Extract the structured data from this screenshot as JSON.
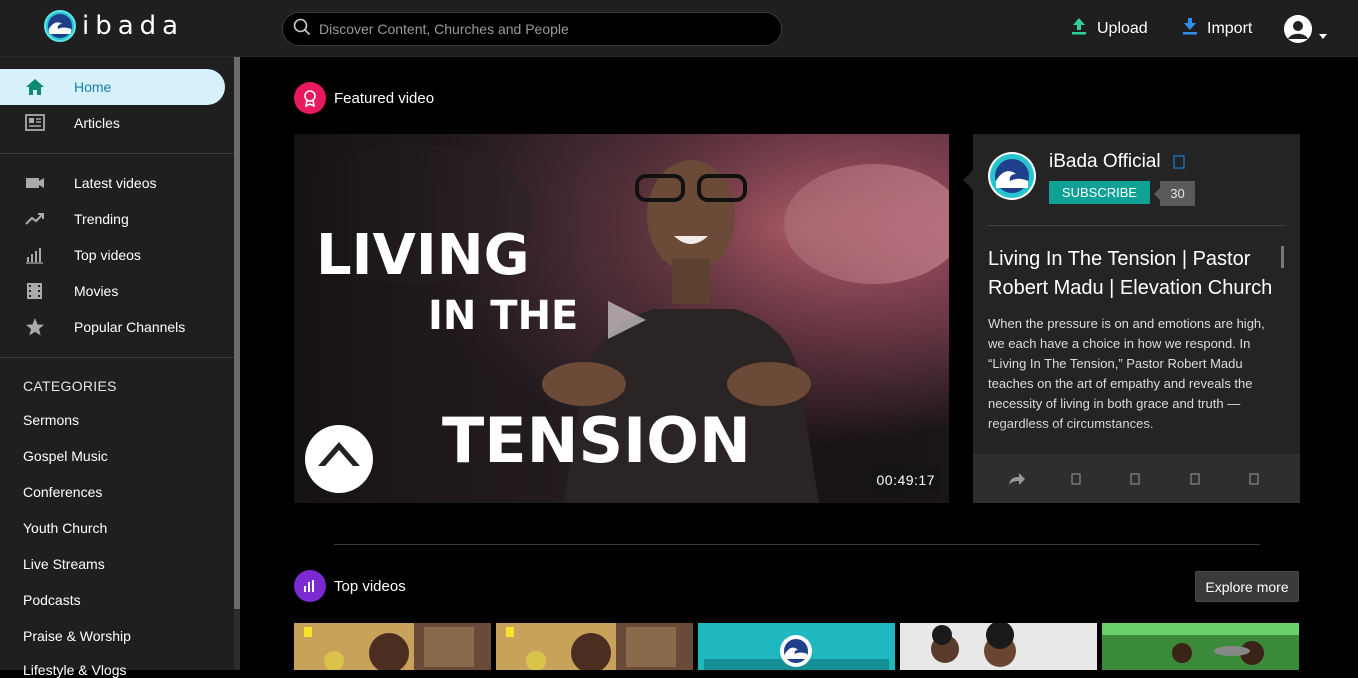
{
  "header": {
    "logo_text": "ibada",
    "search_placeholder": "Discover Content, Churches and People",
    "upload_label": "Upload",
    "import_label": "Import",
    "accent_color": "#25c5cf"
  },
  "sidebar": {
    "primary": [
      {
        "label": "Home",
        "icon": "home-icon",
        "active": true
      },
      {
        "label": "Articles",
        "icon": "article-icon"
      }
    ],
    "secondary": [
      {
        "label": "Latest videos",
        "icon": "video-camera-icon"
      },
      {
        "label": "Trending",
        "icon": "trending-icon"
      },
      {
        "label": "Top videos",
        "icon": "bar-chart-icon"
      },
      {
        "label": "Movies",
        "icon": "film-icon"
      },
      {
        "label": "Popular Channels",
        "icon": "star-icon"
      }
    ],
    "categories_heading": "CATEGORIES",
    "categories": [
      "Sermons",
      "Gospel Music",
      "Conferences",
      "Youth Church",
      "Live Streams",
      "Podcasts",
      "Praise & Worship",
      "Lifestyle & Vlogs"
    ]
  },
  "featured": {
    "section_title": "Featured video",
    "thumbnail_text_1": "LIVING",
    "thumbnail_text_2": "IN THE",
    "thumbnail_text_3": "TENSION",
    "duration": "00:49:17",
    "channel_name": "iBada Official",
    "subscribe_label": "SUBSCRIBE",
    "subscriber_count": "30",
    "title": "Living In The Tension | Pastor Robert Madu | Elevation Church",
    "description": "When the pressure is on and emotions are high, we each have a choice in how we respond. In “Living In The Tension,” Pastor Robert Madu teaches on the art of empathy and reveals the necessity of living in both grace and truth — regardless of circumstances."
  },
  "top_videos": {
    "section_title": "Top videos",
    "explore_label": "Explore more"
  }
}
